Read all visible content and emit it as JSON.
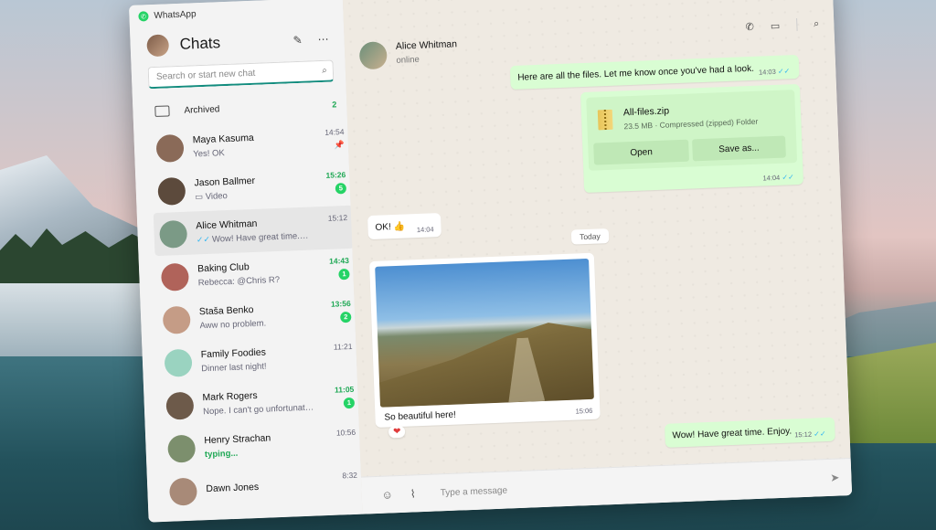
{
  "app": {
    "name": "WhatsApp"
  },
  "window_controls": {
    "minimize": "─",
    "maximize": "☐",
    "close": "✕"
  },
  "sidebar": {
    "title": "Chats",
    "search": {
      "placeholder": "Search or start new chat",
      "value": ""
    },
    "archived": {
      "label": "Archived",
      "count": "2"
    },
    "chats": [
      {
        "name": "Maya Kasuma",
        "preview": "Yes! OK",
        "time": "14:54",
        "pinned": true,
        "avatar_color": "#8a6a58"
      },
      {
        "name": "Jason Ballmer",
        "preview": "Video",
        "time": "15:26",
        "unread": "5",
        "avatar_color": "#5c4a3c"
      },
      {
        "name": "Alice Whitman",
        "preview": "Wow! Have great time. Enjoy.",
        "time": "15:12",
        "selected": true,
        "avatar_color": "#7b9a86"
      },
      {
        "name": "Baking Club",
        "preview": "Rebecca: @Chris R?",
        "time": "14:43",
        "unread": "1",
        "avatar_color": "#b0635a"
      },
      {
        "name": "Staša Benko",
        "preview": "Aww no problem.",
        "time": "13:56",
        "unread": "2",
        "avatar_color": "#c59c86"
      },
      {
        "name": "Family Foodies",
        "preview": "Dinner last night!",
        "time": "11:21",
        "avatar_color": "#9ad3c0"
      },
      {
        "name": "Mark Rogers",
        "preview": "Nope. I can't go unfortunately.",
        "time": "11:05",
        "unread": "1",
        "avatar_color": "#6d5a4a"
      },
      {
        "name": "Henry Strachan",
        "preview": "typing...",
        "time": "10:56",
        "typing": true,
        "avatar_color": "#7c8f6d"
      },
      {
        "name": "Dawn Jones",
        "preview": "",
        "time": "8:32",
        "avatar_color": "#a88a78"
      }
    ]
  },
  "conversation": {
    "contact_name": "Alice Whitman",
    "status": "online",
    "messages": {
      "m1": {
        "text": "Here are all the files. Let me know once you've had a look.",
        "time": "14:03"
      },
      "file": {
        "name": "All-files.zip",
        "info": "23.5 MB · Compressed (zipped) Folder",
        "open_label": "Open",
        "save_label": "Save as...",
        "time": "14:04"
      },
      "m2": {
        "text": "OK! 👍",
        "time": "14:04"
      },
      "day_label": "Today",
      "photo": {
        "caption": "So beautiful here!",
        "time": "15:06",
        "reaction": "❤"
      },
      "m3": {
        "text": "Wow! Have great time. Enjoy.",
        "time": "15:12"
      }
    },
    "composer": {
      "placeholder": "Type a message"
    }
  },
  "colors": {
    "accent": "#25d366",
    "outgoing": "#d9fdd3",
    "read_tick": "#34b7f1"
  }
}
